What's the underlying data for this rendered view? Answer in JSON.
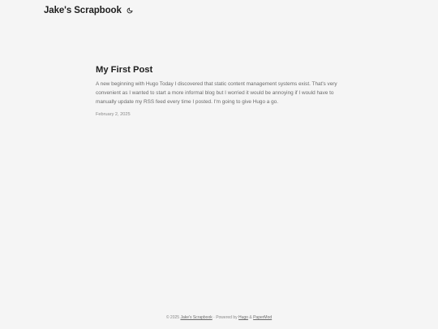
{
  "header": {
    "site_title": "Jake's Scrapbook",
    "theme_toggle_icon": "moon-icon"
  },
  "posts": [
    {
      "title": "My First Post",
      "summary": "A new beginning with Hugo Today I discovered that static content management systems exist. That's very convenient as I wanted to start a more informal blog but I worried it would be annoying if I would have to manually update my RSS feed every time I posted. I'm going to give Hugo a go.",
      "date": "February 2, 2025"
    }
  ],
  "footer": {
    "copyright": "© 2025",
    "site_link": "Jake's Scrapbook",
    "powered_by": "· Powered by",
    "hugo_link": "Hugo",
    "amp": "&",
    "papermod_link": "PaperMod"
  }
}
